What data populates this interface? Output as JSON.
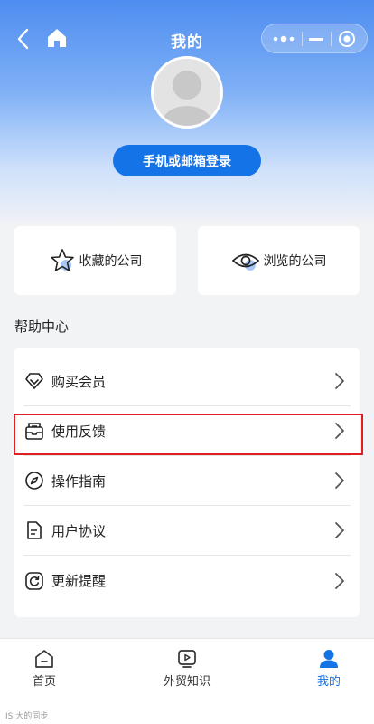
{
  "header": {
    "title": "我的",
    "back_icon": "back-icon",
    "home_icon": "home-icon",
    "capsule": {
      "more_icon": "more-dots-icon",
      "minimize_icon": "minus-icon",
      "close_icon": "target-icon"
    }
  },
  "profile": {
    "avatar_icon": "user-avatar-icon",
    "login_label": "手机或邮箱登录"
  },
  "quick_links": [
    {
      "label": "收藏的公司",
      "icon": "star-icon"
    },
    {
      "label": "浏览的公司",
      "icon": "eye-icon"
    }
  ],
  "help": {
    "title": "帮助中心",
    "items": [
      {
        "label": "购买会员",
        "icon": "diamond-icon"
      },
      {
        "label": "使用反馈",
        "icon": "feedback-inbox-icon"
      },
      {
        "label": "操作指南",
        "icon": "compass-icon"
      },
      {
        "label": "用户协议",
        "icon": "document-icon"
      },
      {
        "label": "更新提醒",
        "icon": "refresh-icon"
      }
    ]
  },
  "tabbar": [
    {
      "label": "首页",
      "icon": "home-tab-icon",
      "active": false
    },
    {
      "label": "外贸知识",
      "icon": "video-tab-icon",
      "active": false
    },
    {
      "label": "我的",
      "icon": "person-tab-icon",
      "active": true
    }
  ],
  "colors": {
    "accent": "#1473e6",
    "highlight_border": "#e02020",
    "header_top": "#4e8df0"
  },
  "watermark": "IS 大的同步"
}
